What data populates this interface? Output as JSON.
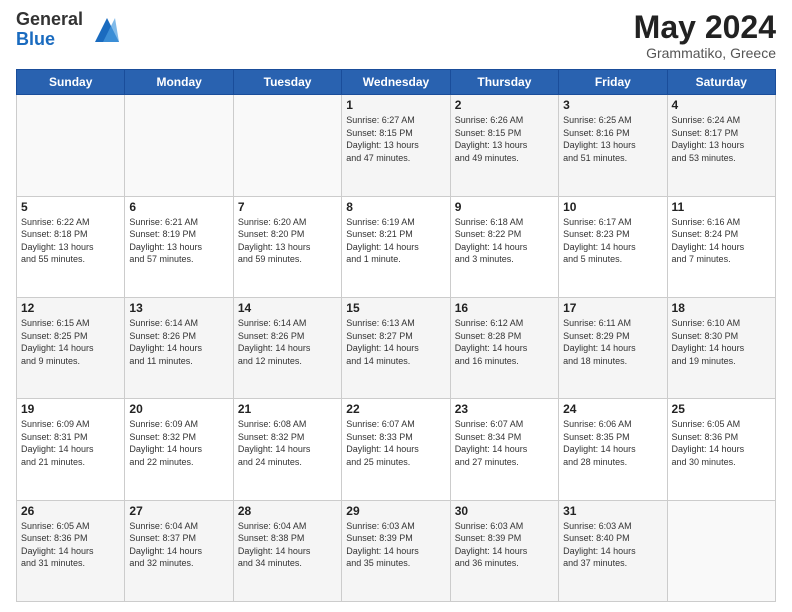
{
  "logo": {
    "general": "General",
    "blue": "Blue"
  },
  "header": {
    "month": "May 2024",
    "location": "Grammatiko, Greece"
  },
  "weekdays": [
    "Sunday",
    "Monday",
    "Tuesday",
    "Wednesday",
    "Thursday",
    "Friday",
    "Saturday"
  ],
  "weeks": [
    [
      {
        "day": "",
        "info": ""
      },
      {
        "day": "",
        "info": ""
      },
      {
        "day": "",
        "info": ""
      },
      {
        "day": "1",
        "info": "Sunrise: 6:27 AM\nSunset: 8:15 PM\nDaylight: 13 hours\nand 47 minutes."
      },
      {
        "day": "2",
        "info": "Sunrise: 6:26 AM\nSunset: 8:15 PM\nDaylight: 13 hours\nand 49 minutes."
      },
      {
        "day": "3",
        "info": "Sunrise: 6:25 AM\nSunset: 8:16 PM\nDaylight: 13 hours\nand 51 minutes."
      },
      {
        "day": "4",
        "info": "Sunrise: 6:24 AM\nSunset: 8:17 PM\nDaylight: 13 hours\nand 53 minutes."
      }
    ],
    [
      {
        "day": "5",
        "info": "Sunrise: 6:22 AM\nSunset: 8:18 PM\nDaylight: 13 hours\nand 55 minutes."
      },
      {
        "day": "6",
        "info": "Sunrise: 6:21 AM\nSunset: 8:19 PM\nDaylight: 13 hours\nand 57 minutes."
      },
      {
        "day": "7",
        "info": "Sunrise: 6:20 AM\nSunset: 8:20 PM\nDaylight: 13 hours\nand 59 minutes."
      },
      {
        "day": "8",
        "info": "Sunrise: 6:19 AM\nSunset: 8:21 PM\nDaylight: 14 hours\nand 1 minute."
      },
      {
        "day": "9",
        "info": "Sunrise: 6:18 AM\nSunset: 8:22 PM\nDaylight: 14 hours\nand 3 minutes."
      },
      {
        "day": "10",
        "info": "Sunrise: 6:17 AM\nSunset: 8:23 PM\nDaylight: 14 hours\nand 5 minutes."
      },
      {
        "day": "11",
        "info": "Sunrise: 6:16 AM\nSunset: 8:24 PM\nDaylight: 14 hours\nand 7 minutes."
      }
    ],
    [
      {
        "day": "12",
        "info": "Sunrise: 6:15 AM\nSunset: 8:25 PM\nDaylight: 14 hours\nand 9 minutes."
      },
      {
        "day": "13",
        "info": "Sunrise: 6:14 AM\nSunset: 8:26 PM\nDaylight: 14 hours\nand 11 minutes."
      },
      {
        "day": "14",
        "info": "Sunrise: 6:14 AM\nSunset: 8:26 PM\nDaylight: 14 hours\nand 12 minutes."
      },
      {
        "day": "15",
        "info": "Sunrise: 6:13 AM\nSunset: 8:27 PM\nDaylight: 14 hours\nand 14 minutes."
      },
      {
        "day": "16",
        "info": "Sunrise: 6:12 AM\nSunset: 8:28 PM\nDaylight: 14 hours\nand 16 minutes."
      },
      {
        "day": "17",
        "info": "Sunrise: 6:11 AM\nSunset: 8:29 PM\nDaylight: 14 hours\nand 18 minutes."
      },
      {
        "day": "18",
        "info": "Sunrise: 6:10 AM\nSunset: 8:30 PM\nDaylight: 14 hours\nand 19 minutes."
      }
    ],
    [
      {
        "day": "19",
        "info": "Sunrise: 6:09 AM\nSunset: 8:31 PM\nDaylight: 14 hours\nand 21 minutes."
      },
      {
        "day": "20",
        "info": "Sunrise: 6:09 AM\nSunset: 8:32 PM\nDaylight: 14 hours\nand 22 minutes."
      },
      {
        "day": "21",
        "info": "Sunrise: 6:08 AM\nSunset: 8:32 PM\nDaylight: 14 hours\nand 24 minutes."
      },
      {
        "day": "22",
        "info": "Sunrise: 6:07 AM\nSunset: 8:33 PM\nDaylight: 14 hours\nand 25 minutes."
      },
      {
        "day": "23",
        "info": "Sunrise: 6:07 AM\nSunset: 8:34 PM\nDaylight: 14 hours\nand 27 minutes."
      },
      {
        "day": "24",
        "info": "Sunrise: 6:06 AM\nSunset: 8:35 PM\nDaylight: 14 hours\nand 28 minutes."
      },
      {
        "day": "25",
        "info": "Sunrise: 6:05 AM\nSunset: 8:36 PM\nDaylight: 14 hours\nand 30 minutes."
      }
    ],
    [
      {
        "day": "26",
        "info": "Sunrise: 6:05 AM\nSunset: 8:36 PM\nDaylight: 14 hours\nand 31 minutes."
      },
      {
        "day": "27",
        "info": "Sunrise: 6:04 AM\nSunset: 8:37 PM\nDaylight: 14 hours\nand 32 minutes."
      },
      {
        "day": "28",
        "info": "Sunrise: 6:04 AM\nSunset: 8:38 PM\nDaylight: 14 hours\nand 34 minutes."
      },
      {
        "day": "29",
        "info": "Sunrise: 6:03 AM\nSunset: 8:39 PM\nDaylight: 14 hours\nand 35 minutes."
      },
      {
        "day": "30",
        "info": "Sunrise: 6:03 AM\nSunset: 8:39 PM\nDaylight: 14 hours\nand 36 minutes."
      },
      {
        "day": "31",
        "info": "Sunrise: 6:03 AM\nSunset: 8:40 PM\nDaylight: 14 hours\nand 37 minutes."
      },
      {
        "day": "",
        "info": ""
      }
    ]
  ]
}
